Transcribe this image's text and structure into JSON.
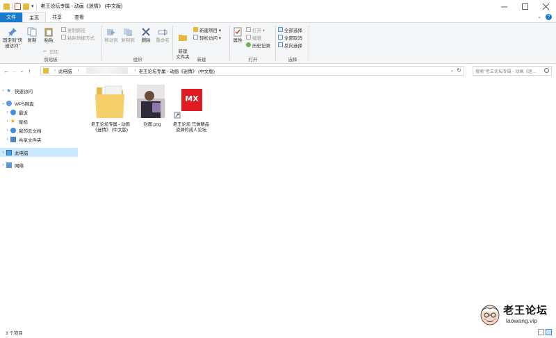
{
  "window": {
    "title": "老王论坛专属 - 动画《迷情》 (中文版)",
    "quick_access_arrow": "▾"
  },
  "tabs": [
    {
      "label": "文件"
    },
    {
      "label": "主页"
    },
    {
      "label": "共享"
    },
    {
      "label": "查看"
    }
  ],
  "ribbon": {
    "clipboard": {
      "pin_label": "固定到\"快速访问\"",
      "copy_label": "复制",
      "paste_label": "粘贴",
      "copy_path_label": "复制路径",
      "paste_shortcut_label": "粘贴快捷方式",
      "cut_label": "剪切",
      "group_label": "剪贴板"
    },
    "organize": {
      "move_to_label": "移动到",
      "copy_to_label": "复制到",
      "delete_label": "删除",
      "rename_label": "重命名",
      "group_label": "组织"
    },
    "new": {
      "new_folder_label": "新建\n文件夹",
      "new_item_label": "新建项目 ▾",
      "easy_access_label": "轻松访问 ▾",
      "group_label": "新建"
    },
    "open": {
      "properties_label": "属性",
      "open_label": "打开 ▾",
      "edit_label": "编辑",
      "history_label": "历史记录",
      "group_label": "打开"
    },
    "select": {
      "select_all_label": "全部选择",
      "select_none_label": "全部取消",
      "invert_label": "反向选择",
      "group_label": "选择"
    }
  },
  "address": {
    "this_pc": "此电脑",
    "current_folder": "老王论坛专属 - 动画《迷情》 (中文版)",
    "search_placeholder": "搜索\"老王论坛专属 - 动画《迷...",
    "dropdown": "⌄",
    "refresh": "↻"
  },
  "nav": {
    "quick_access": "快速访问",
    "wps": "WPS网盘",
    "recent": "最近",
    "starred": "星标",
    "my_cloud_docs": "我的云文档",
    "shared_folder": "共享文件夹",
    "this_pc": "此电脑",
    "network": "网络"
  },
  "files": [
    {
      "name": "老王论坛专属 - 动画《迷情》 (中文版)",
      "type": "folder"
    },
    {
      "name": "封面.png",
      "type": "image"
    },
    {
      "name": "老王论坛 只做精品资源的成人论坛",
      "type": "shortcut",
      "icon_text": "MX"
    }
  ],
  "status": {
    "item_count": "3 个项目"
  },
  "watermark": {
    "title": "老王论坛",
    "url": "laowang.vip"
  },
  "colors": {
    "accent": "#1979ca",
    "selection": "#cce8ff",
    "folder": "#e8b93c",
    "mx_red": "#e11b22"
  }
}
